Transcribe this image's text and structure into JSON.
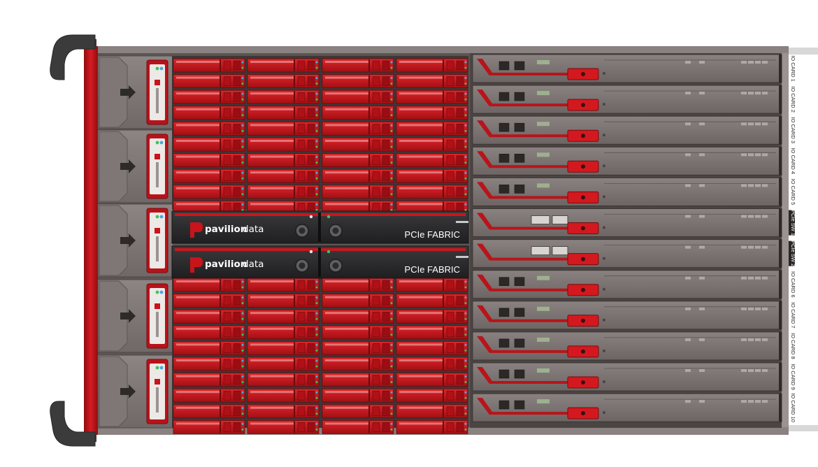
{
  "brand": {
    "name_bold": "pavilion",
    "name_light": "data"
  },
  "fabric_modules": [
    {
      "label": "PCIe FABRIC"
    },
    {
      "label": "PCIe FABRIC"
    }
  ],
  "slot_labels": [
    "IO CARD 1",
    "IO CARD 2",
    "IO CARD 3",
    "IO CARD 4",
    "IO CARD 5",
    "PCIe SW 1",
    "PCIe SW 2",
    "IO CARD 6",
    "IO CARD 7",
    "IO CARD 8",
    "IO CARD 9",
    "IO CARD 10"
  ],
  "colors": {
    "accent_red": "#c8141a",
    "chassis": "#7a7270",
    "module_dark": "#2a2a2c",
    "led_green": "#3ec45a",
    "led_blue": "#47a7e6"
  },
  "icons": {
    "fan_arrow": "arrow-right",
    "handle": "chassis-handle",
    "port": "rj45-port"
  }
}
